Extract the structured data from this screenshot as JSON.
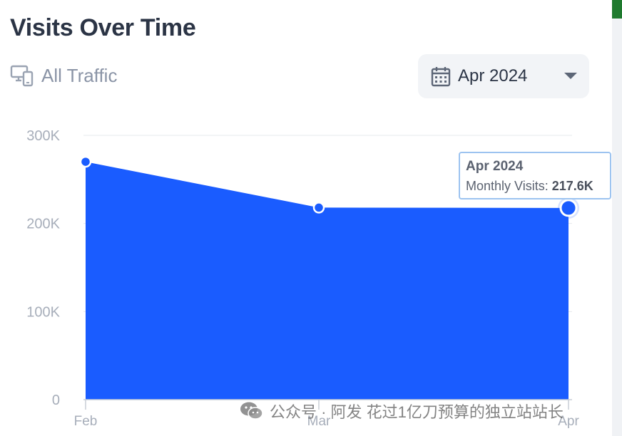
{
  "header": {
    "title": "Visits Over Time"
  },
  "filter": {
    "label": "All Traffic",
    "icon": "devices-icon"
  },
  "date_select": {
    "value": "Apr 2024",
    "icon": "calendar-icon",
    "caret": "chevron-down-icon"
  },
  "tooltip": {
    "title": "Apr 2024",
    "metric_label": "Monthly Visits:",
    "metric_value": "217.6K"
  },
  "watermark": {
    "text": "公众号 · 阿发 花过1亿刀预算的独立站站长"
  },
  "colors": {
    "area": "#1a5cff",
    "point": "#1a5cff",
    "grid": "#e6e8ec",
    "axis_text": "#a7aeba"
  },
  "chart_data": {
    "type": "area",
    "title": "Visits Over Time",
    "categories": [
      "Feb",
      "Mar",
      "Apr"
    ],
    "series": [
      {
        "values": [
          270000,
          218000,
          217600
        ]
      }
    ],
    "yticks": [
      "0",
      "100K",
      "200K",
      "300K"
    ],
    "ytick_values": [
      0,
      100000,
      200000,
      300000
    ],
    "ylim": [
      0,
      300000
    ],
    "grid": true,
    "legend": "none"
  }
}
